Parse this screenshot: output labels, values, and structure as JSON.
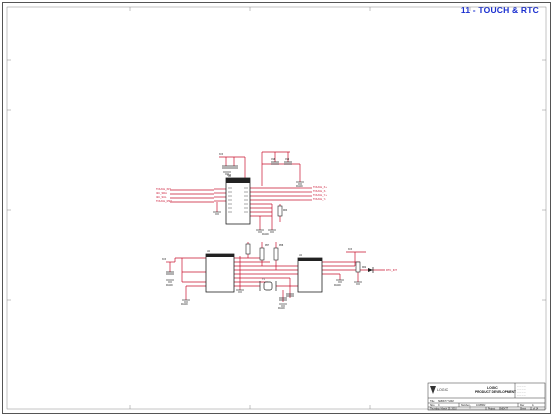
{
  "sheet_title": "11 - TOUCH & RTC",
  "title_block": {
    "company_name": "LOGIC",
    "dept_line1": "LOGIC",
    "dept_line2": "PRODUCT DEVELOPMENT",
    "title_label": "Title",
    "title_value": "SMDK77 SOM",
    "size_label": "Size",
    "size_value": "C",
    "number_label": "Number",
    "number_value": "1018562",
    "rev_label": "Rev",
    "rev_value": "A",
    "date_label": "Thursday, March 25, 2010",
    "project_label": "Project",
    "project_value": "SMDK77",
    "sheet_label": "Sheet",
    "sheet_value": "11 of 14"
  },
  "colors": {
    "wire": "#c8102e",
    "title": "#1a2fd0",
    "ink": "#222222"
  }
}
